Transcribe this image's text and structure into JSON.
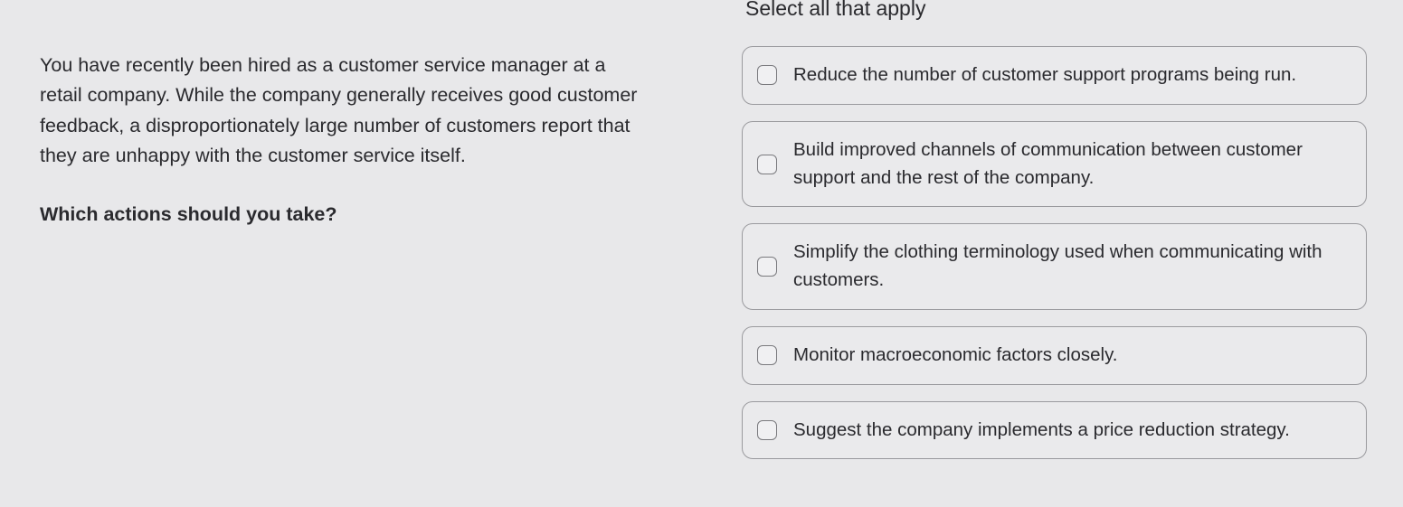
{
  "question": {
    "scenario": "You have recently been hired as a customer service manager at a retail company. While the company generally receives good customer feedback, a disproportionately large number of customers report that they are unhappy with the customer service itself.",
    "prompt": "Which actions should you take?"
  },
  "answers": {
    "instruction": "Select all that apply",
    "options": [
      {
        "label": "Reduce the number of customer support programs being run."
      },
      {
        "label": "Build improved channels of communication between customer support and the rest of the company."
      },
      {
        "label": "Simplify the clothing terminology used when communicating with customers."
      },
      {
        "label": "Monitor macroeconomic factors closely."
      },
      {
        "label": "Suggest the company implements a price reduction strategy."
      }
    ]
  }
}
